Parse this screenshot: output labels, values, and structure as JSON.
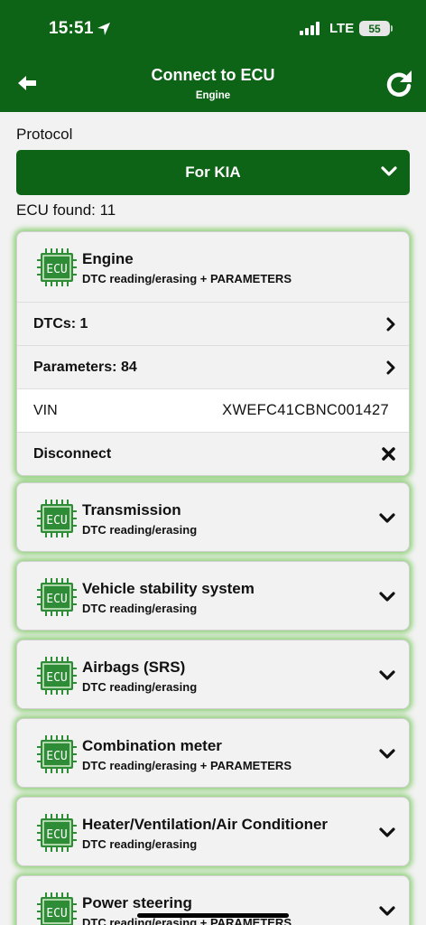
{
  "status_bar": {
    "time": "15:51",
    "network": "LTE",
    "battery": "55"
  },
  "header": {
    "title": "Connect to ECU",
    "subtitle": "Engine"
  },
  "protocol": {
    "label": "Protocol",
    "selected": "For KIA"
  },
  "ecu_found": "ECU found: 11",
  "icon_text": "ECU",
  "expanded_ecu": {
    "name": "Engine",
    "description": "DTC reading/erasing + PARAMETERS",
    "rows": {
      "dtcs": "DTCs: 1",
      "parameters": "Parameters: 84",
      "vin_label": "VIN",
      "vin_value": "XWEFC41CBNC001427",
      "disconnect": "Disconnect"
    }
  },
  "ecus": [
    {
      "name": "Transmission",
      "description": "DTC reading/erasing"
    },
    {
      "name": "Vehicle stability system",
      "description": "DTC reading/erasing"
    },
    {
      "name": "Airbags (SRS)",
      "description": "DTC reading/erasing"
    },
    {
      "name": "Combination meter",
      "description": "DTC reading/erasing + PARAMETERS"
    },
    {
      "name": "Heater/Ventilation/Air Conditioner",
      "description": "DTC reading/erasing"
    },
    {
      "name": "Power steering",
      "description": "DTC reading/erasing + PARAMETERS"
    }
  ],
  "colors": {
    "brand_green": "#0d6416",
    "card_glow": "#76c85a"
  }
}
